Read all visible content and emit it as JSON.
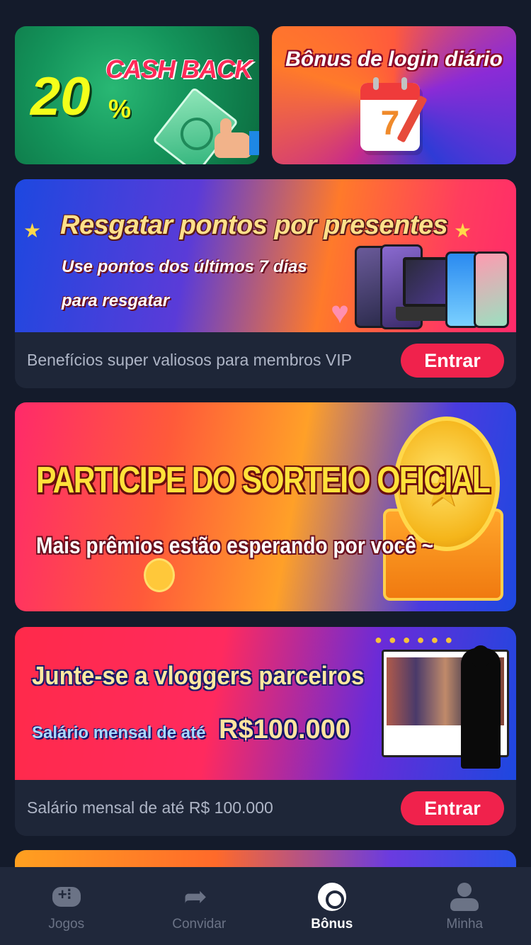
{
  "promos": {
    "cashback": {
      "percent": "20",
      "percent_sign": "%",
      "title": "CASH BACK"
    },
    "daily_login": {
      "title": "Bônus de login diário",
      "calendar_day": "7"
    }
  },
  "redeem": {
    "title": "Resgatar pontos por presentes",
    "line1": "Use pontos dos últimos 7 dias",
    "line2": "para resgatar",
    "footer_text": "Benefícios super valiosos para membros VIP",
    "button_label": "Entrar"
  },
  "raffle": {
    "title": "PARTICIPE DO SORTEIO OFICIAL",
    "subtitle": "Mais prêmios estão esperando por você ~"
  },
  "vloggers": {
    "title": "Junte-se a vloggers parceiros",
    "salary_label": "Salário mensal de até",
    "salary_amount": "R$100.000",
    "footer_text": "Salário mensal de até R$ 100.000",
    "button_label": "Entrar"
  },
  "tabbar": {
    "tabs": [
      {
        "label": "Jogos",
        "icon": "gamepad-icon",
        "active": false
      },
      {
        "label": "Convidar",
        "icon": "share-arrow-icon",
        "active": false
      },
      {
        "label": "Bônus",
        "icon": "bonus-icon",
        "active": true
      },
      {
        "label": "Minha",
        "icon": "user-icon",
        "active": false
      }
    ]
  },
  "colors": {
    "background": "#141b2b",
    "card_footer": "#1e2638",
    "button": "#f0224c",
    "tabbar": "#20283b",
    "tab_inactive": "#6b7386",
    "tab_active": "#ffffff"
  }
}
